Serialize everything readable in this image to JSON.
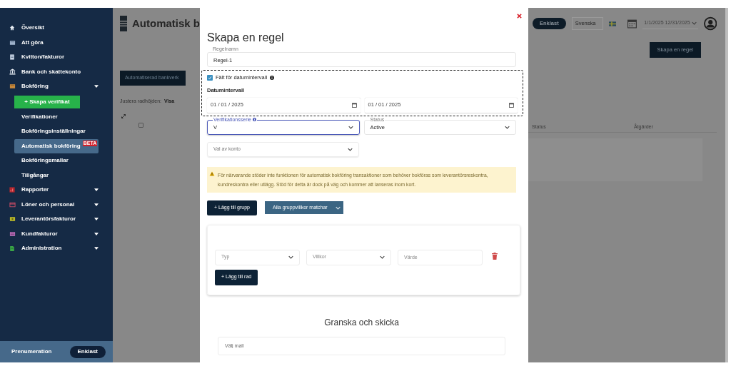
{
  "sidebar": {
    "items": [
      {
        "label": "Översikt"
      },
      {
        "label": "Att göra"
      },
      {
        "label": "Kvitton/fakturor"
      },
      {
        "label": "Bank och skattekonto"
      },
      {
        "label": "Bokföring",
        "expanded": true,
        "children": [
          {
            "kind": "button",
            "label": "+ Skapa verifikat",
            "selected": false
          },
          {
            "kind": "link",
            "label": "Verifikationer",
            "selected": false
          },
          {
            "kind": "link",
            "label": "Bokföringsinställningar",
            "selected": false
          },
          {
            "kind": "link",
            "label": "Automatisk bokföring",
            "selected": true,
            "badge": "BETA"
          },
          {
            "kind": "link",
            "label": "Bokföringsmallar",
            "selected": false
          },
          {
            "kind": "link",
            "label": "Tillgångar",
            "selected": false
          }
        ]
      },
      {
        "label": "Rapporter",
        "expanded": false
      },
      {
        "label": "Löner och personal",
        "expanded": false
      },
      {
        "label": "Leverantörsfakturor",
        "expanded": false
      },
      {
        "label": "Kundfakturor",
        "expanded": false
      },
      {
        "label": "Administration",
        "expanded": false
      }
    ],
    "footer": {
      "label": "Prenumeration",
      "plan": "Enklast"
    }
  },
  "page": {
    "title": "Automatisk b",
    "plan_badge": "Enklast",
    "language": "Svenska",
    "date_range": "1/1/2025 12/31/2025",
    "create_button": "Skapa en regel",
    "bank_button": "Automatiserad bankverk",
    "row_height_label": "Justera radhöjden:",
    "row_height_value": "Visa",
    "table": {
      "select_all_checked": false,
      "columns": [
        "Status",
        "Åtgärder"
      ]
    }
  },
  "modal": {
    "title": "Skapa en regel",
    "name_field": {
      "label": "Regelnamn",
      "value": "Regel-1"
    },
    "date_range": {
      "checkbox": {
        "label": "Fält för datumintervall",
        "checked": true
      },
      "heading": "Datumintervall",
      "from": "01 / 01 / 2025",
      "to": "01 / 01 / 2025"
    },
    "selects": [
      {
        "label": "Verifikationsserie",
        "value": "V",
        "focused": true,
        "info": true
      },
      {
        "label": "Status",
        "value": "Active",
        "focused": false,
        "info": false
      }
    ],
    "account_select": {
      "placeholder": "Val av konto"
    },
    "warning": "För närvarande stöder inte funktionen för automatisk bokföring transaktioner som behöver bokföras som leverantörsreskontra, kundreskontra eller utlägg. Stöd för detta är dock på väg och kommer att lanseras inom kort.",
    "add_group_button": "+ Lägg till grupp",
    "match_dropdown": "Alla gruppvillkor matchar",
    "group": {
      "rows": [
        {
          "type_placeholder": "Typ",
          "condition_placeholder": "Villkor",
          "value_placeholder": "Värde"
        }
      ],
      "add_row_button": "+ Lägg till rad"
    },
    "review": {
      "heading": "Granska och skicka",
      "template_placeholder": "Välj mall"
    }
  }
}
